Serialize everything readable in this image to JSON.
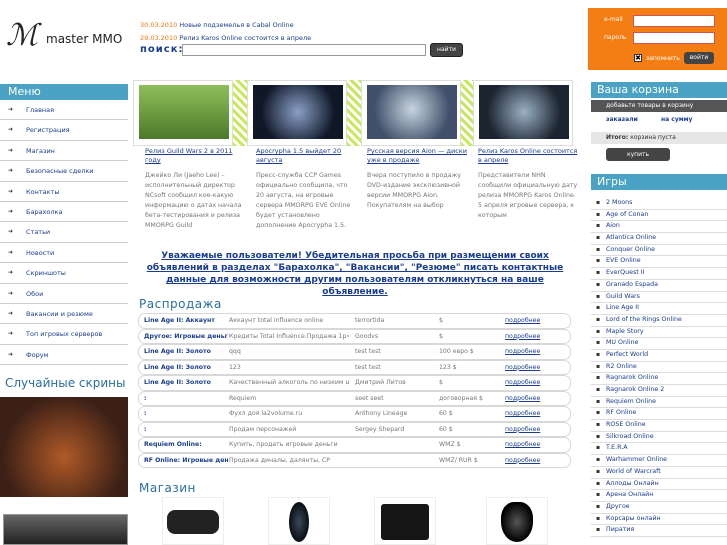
{
  "site": {
    "logo_text": "master MMO"
  },
  "news": [
    {
      "date": "30.03.2010",
      "text": "Новые подземелья в Cabal Online"
    },
    {
      "date": "29.03.2010",
      "text": "Релиз Karos Online состоится в апреле"
    }
  ],
  "search": {
    "label": "поиск:",
    "button": "найти",
    "value": ""
  },
  "login": {
    "email_label": "e-mail",
    "password_label": "пароль",
    "remember_label": "запомнить",
    "remember_mark": "✖",
    "submit": "войти"
  },
  "left_menu": {
    "title": "Меню",
    "items": [
      "Главная",
      "Регистрация",
      "Магазин",
      "Безопасные сделки",
      "Контакты",
      "Барахолка",
      "Статьи",
      "Новости",
      "Скриншоты",
      "Обои",
      "Вакансии и резюме",
      "Топ игровых серверов",
      "Форум"
    ]
  },
  "random_shots": {
    "title": "Случайные скрины"
  },
  "articles": [
    {
      "title": "Релиз Guild Wars 2 в 2011 году",
      "body": "Джейко Ли (Jaeho Lee) – исполнительный директор NCsoft сообщил кое-какую информацию о датах начала бета-тестирования и релиза MMORPG Guild"
    },
    {
      "title": "Apocrypha 1.5 выйдет 20 августа",
      "body": "Пресс-служба CCP Games официально сообщила, что 20 августа, на игровые сервера MMORPG EVE Online будет установлено дополнение Apocrypha 1.5."
    },
    {
      "title": "Русская версия Aion — диски уже в продаже",
      "body": "Вчера поступило в продажу DVD-издание эксклюзивной версии MMORPG Aion. Покупателям на выбор"
    },
    {
      "title": "Релиз Karos Online состоится в апреле",
      "body": "Представители NHN сообщили официальную дату релиза MMORPG Karos Online. 5 апреля игровые сервера, к которым"
    }
  ],
  "notice": "Уважаемые пользователи! Убедительная просьба при размещении своих объявлений в разделах \"Барахолка\", \"Вакансии\", \"Резюме\" писать контактные данные для возможности другим пользователям откликнуться на ваше объявление.",
  "sales": {
    "title": "Распродажа",
    "rows": [
      {
        "game": "Line Age II: Аккаунт",
        "desc": "Аккаунт total influence online",
        "seller": "terrortida",
        "price": "$",
        "more": "подробнее"
      },
      {
        "game": "Другое: Игровые деньги",
        "desc": "Кредиты Total Influence.Продажа 1р=400кр",
        "seller": "Goodvs",
        "price": "$",
        "more": "подробнее"
      },
      {
        "game": "Line Age II: Золото",
        "desc": "qqq",
        "seller": "test test",
        "price": "100 евро $",
        "more": "подробнее"
      },
      {
        "game": "Line Age II: Золото",
        "desc": "123",
        "seller": "test test",
        "price": "123 $",
        "more": "подробнее"
      },
      {
        "game": "Line Age II: Золото",
        "desc": "Качественный алкоголь по низким ценам",
        "seller": "Дмитрий Литов",
        "price": "$",
        "more": "подробнее"
      },
      {
        "game": ":",
        "desc": "Requiem",
        "seller": "seet seet",
        "price": "договорная $",
        "more": "подробнее"
      },
      {
        "game": ":",
        "desc": "Фухл доя la2volume.ru",
        "seller": "Anthony Lineage",
        "price": "60 $",
        "more": "подробнее"
      },
      {
        "game": ":",
        "desc": "Продам персонажей",
        "seller": "Sergey Shepard",
        "price": "60 $",
        "more": "подробнее"
      },
      {
        "game": "Requiem Online:",
        "desc": "Купить, продать игровые деньги",
        "seller": "",
        "price": "WMZ $",
        "more": "подробнее"
      },
      {
        "game": "RF Online: Игровые деньги",
        "desc": "Продажа диналы, далянты, CP",
        "seller": "",
        "price": "WMZ/ RUR $",
        "more": "подробнее"
      }
    ]
  },
  "shop": {
    "title": "Магазин"
  },
  "cart": {
    "title": "Ваша корзина",
    "subtitle": "добавьте товары в корзину",
    "col_ordered": "заказали",
    "col_sum": "на сумму",
    "total_label": "Итого:",
    "total_value": "корзина пуста",
    "button": "купить"
  },
  "games": {
    "title": "Игры",
    "items": [
      "2 Moons",
      "Age of Conan",
      "Aion",
      "Atlantica Online",
      "Conquer Online",
      "EVE Online",
      "EverQuest II",
      "Granado Espada",
      "Guild Wars",
      "Line Age II",
      "Lord of the Rings Online",
      "Maple Story",
      "MU Online",
      "Perfect World",
      "R2 Online",
      "Ragnarok Online",
      "Ragnarok Online 2",
      "Requiem Online",
      "RF Online",
      "ROSE Online",
      "Silkroad Online",
      "T.E.R.A",
      "Warhammer Online",
      "World of Warcraft",
      "Аллоды Онлайн",
      "Арена Онлайн",
      "Другое",
      "Корсары онлайн",
      "Пиратия"
    ]
  },
  "colors": {
    "accent": "#f57e14",
    "header_blue": "#4aa3c5",
    "link": "#1a3d8f"
  }
}
